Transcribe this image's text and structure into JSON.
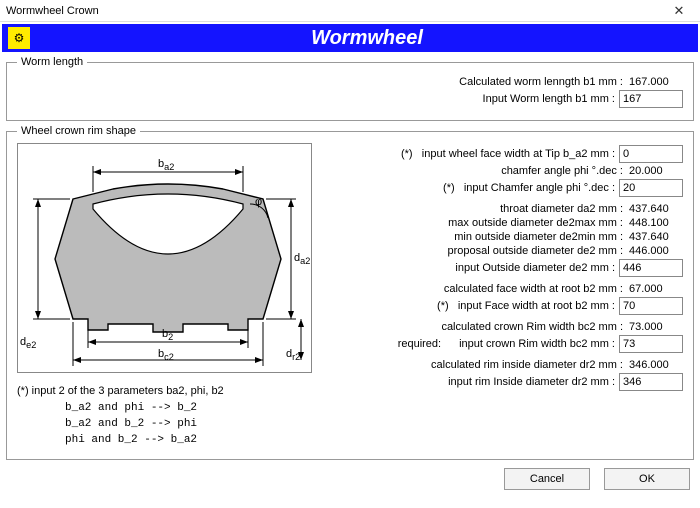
{
  "window": {
    "title": "Wormwheel Crown",
    "close": "✕"
  },
  "banner": {
    "title": "Wormwheel"
  },
  "worm_length": {
    "legend": "Worm length",
    "calc_label": "Calculated worm lenngth   b1   mm :",
    "calc_value": "167.000",
    "input_label": "Input Worm length   b1   mm :",
    "input_value": "167"
  },
  "crown": {
    "legend": "Wheel crown rim shape",
    "note_heading": "(*) input 2 of the 3 parameters ba2, phi, b2",
    "rules": [
      "b_a2 and phi  --> b_2",
      "b_a2 and b_2  --> phi",
      "phi and b_2   --> b_a2"
    ],
    "face_tip_label": "input wheel face width at Tip   b_a2  mm :",
    "face_tip_value": "0",
    "chamfer_calc_label": "chamfer angle phi  °.dec :",
    "chamfer_calc_value": "20.000",
    "chamfer_in_label": "input Chamfer angle phi  °.dec :",
    "chamfer_in_value": "20",
    "throat_label": "throat diameter  da2   mm :",
    "throat_value": "437.640",
    "de2max_label": "max outside diameter de2max mm :",
    "de2max_value": "448.100",
    "de2min_label": "min outside diameter de2min mm :",
    "de2min_value": "437.640",
    "de2prop_label": "proposal outside diameter de2 mm :",
    "de2prop_value": "446.000",
    "de2in_label": "input Outside diameter de2 mm :",
    "de2in_value": "446",
    "b2calc_label": "calculated face width at root   b2 mm :",
    "b2calc_value": "67.000",
    "b2in_label": "input Face width at root   b2 mm :",
    "b2in_value": "70",
    "bc2calc_label": "calculated crown Rim width  bc2 mm :",
    "bc2calc_value": "73.000",
    "bc2in_prefix": "required:",
    "bc2in_label": "input crown Rim width  bc2 mm :",
    "bc2in_value": "73",
    "dr2calc_label": "calculated rim inside diameter  dr2 mm :",
    "dr2calc_value": "346.000",
    "dr2in_label": "input rim Inside diameter  dr2 mm :",
    "dr2in_value": "346"
  },
  "diagram": {
    "ba2": "b",
    "ba2_sub": "a2",
    "b2": "b",
    "b2_sub": "2",
    "bc2": "b",
    "bc2_sub": "c2",
    "da2": "d",
    "da2_sub": "a2",
    "de2": "d",
    "de2_sub": "e2",
    "dr2": "d",
    "dr2_sub": "r2",
    "phi": "φ"
  },
  "buttons": {
    "cancel": "Cancel",
    "ok": "OK"
  }
}
